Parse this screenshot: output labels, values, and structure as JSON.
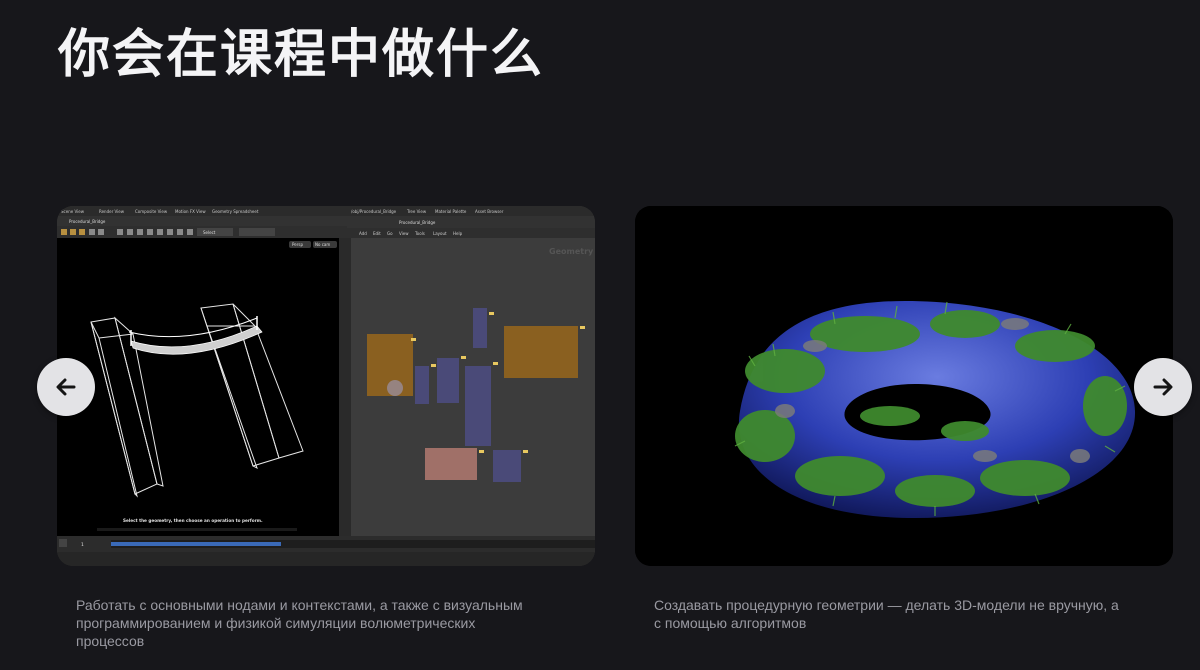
{
  "page": {
    "title": "你会在课程中做什么"
  },
  "slides": [
    {
      "caption": "Работать с основными нодами и контекстами, а также с визуальным программированием и физикой симуляции волюметрических процессов",
      "screenshot": {
        "tabs_left": [
          "Scene View",
          "Render View",
          "Composite View",
          "Motion FX View",
          "Geometry Spreadsheet"
        ],
        "tabs_right": [
          "/obj/Procedural_Bridge",
          "Tree View",
          "Material Palette",
          "Asset Browser"
        ],
        "path_left": "Procedural_Bridge",
        "path_right": "Procedural_Bridge",
        "menu_right": [
          "Add",
          "Edit",
          "Go",
          "View",
          "Tools",
          "Layout",
          "Help"
        ],
        "network_label": "Geometry",
        "viewport_persp": "Persp",
        "viewport_cam": "No cam",
        "selector_mode": "Select",
        "status_line1": "Select the geometry, then choose an operation to perform.",
        "timeline_frame": "1"
      }
    },
    {
      "caption": "Создавать процедурную геометрии — делать 3D-модели не вручную, а с помощью алгоритмов"
    }
  ],
  "controls": {
    "prev_icon": "arrow-left-icon",
    "next_icon": "arrow-right-icon"
  },
  "colors": {
    "background": "#17171b",
    "caption": "#9a9aa2",
    "arrow_bg": "#e3e3e6"
  }
}
